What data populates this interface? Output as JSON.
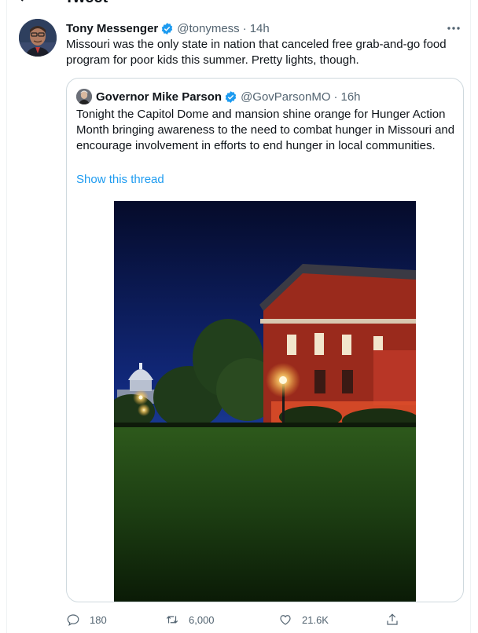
{
  "header": {
    "title": "Tweet"
  },
  "tweet": {
    "author_name": "Tony Messenger",
    "handle": "@tonymess",
    "time": "14h",
    "text": "Missouri was the only state in nation that canceled free grab-and-go food program for poor kids this summer. Pretty lights, though."
  },
  "quote": {
    "author_name": "Governor Mike Parson",
    "handle": "@GovParsonMO",
    "time": "16h",
    "text": "Tonight the Capitol Dome and mansion shine orange for Hunger Action Month bringing awareness to the need to combat hunger in Missouri and encourage involvement in efforts to end hunger in local communities.",
    "show_thread": "Show this thread"
  },
  "actions": {
    "replies": "180",
    "retweets": "6,000",
    "likes": "21.6K"
  },
  "colors": {
    "accent": "#1d9bf0",
    "muted": "#536471",
    "border": "#cfd9de"
  },
  "icons": [
    "back-arrow-icon",
    "verified-icon",
    "more-icon",
    "reply-icon",
    "retweet-icon",
    "like-icon",
    "share-icon"
  ]
}
